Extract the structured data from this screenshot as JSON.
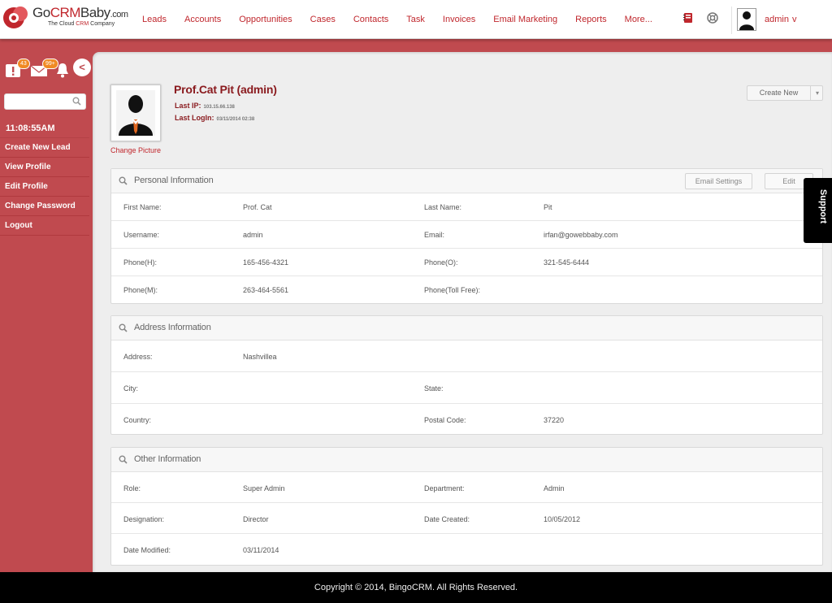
{
  "brand": {
    "name_part1": "Go",
    "name_part2": "CRM",
    "name_part3": "Baby",
    "name_suffix": ".com",
    "tagline_pre": "The Cloud ",
    "tagline_mid": "CRM",
    "tagline_post": " Company",
    "accent_color": "#c0272d",
    "sidebar_color": "#c04a4f"
  },
  "nav": {
    "items": [
      "Leads",
      "Accounts",
      "Opportunities",
      "Cases",
      "Contacts",
      "Task",
      "Invoices",
      "Email Marketing",
      "Reports",
      "More..."
    ]
  },
  "top_icons": [
    "notebook-icon",
    "help-lifebuoy-icon"
  ],
  "user": {
    "name": "admin",
    "caret": "v"
  },
  "sidebar": {
    "alerts_badge": "43",
    "mail_badge": "99+",
    "collapse_symbol": "<",
    "search_placeholder": "",
    "time": "11:08:55AM",
    "links": [
      "Create New Lead",
      "View Profile",
      "Edit Profile",
      "Change Password",
      "Logout"
    ]
  },
  "profile": {
    "name": "Prof.Cat Pit (admin)",
    "last_ip_label": "Last IP:",
    "last_ip": "103.15.66.138",
    "last_login_label": "Last LogIn:",
    "last_login": "03/11/2014 02:38",
    "change_picture": "Change Picture",
    "create_new": "Create New",
    "create_caret": "▾"
  },
  "personal": {
    "title": "Personal Information",
    "email_settings_btn": "Email Settings",
    "edit_btn": "Edit",
    "rows": [
      {
        "l1": "First Name:",
        "v1": "Prof. Cat",
        "l2": "Last Name:",
        "v2": "Pit"
      },
      {
        "l1": "Username:",
        "v1": "admin",
        "l2": "Email:",
        "v2": "irfan@gowebbaby.com"
      },
      {
        "l1": "Phone(H):",
        "v1": "165-456-4321",
        "l2": "Phone(O):",
        "v2": "321-545-6444"
      },
      {
        "l1": "Phone(M):",
        "v1": "263-464-5561",
        "l2": "Phone(Toll Free):",
        "v2": ""
      }
    ]
  },
  "address": {
    "title": "Address Information",
    "rows": [
      {
        "l1": "Address:",
        "v1": "Nashvillea",
        "l2": "",
        "v2": ""
      },
      {
        "l1": "City:",
        "v1": "",
        "l2": "State:",
        "v2": ""
      },
      {
        "l1": "Country:",
        "v1": "",
        "l2": "Postal Code:",
        "v2": "37220"
      }
    ]
  },
  "other": {
    "title": "Other Information",
    "rows": [
      {
        "l1": "Role:",
        "v1": "Super Admin",
        "l2": "Department:",
        "v2": "Admin"
      },
      {
        "l1": "Designation:",
        "v1": "Director",
        "l2": "Date Created:",
        "v2": "10/05/2012"
      },
      {
        "l1": "Date Modified:",
        "v1": "03/11/2014",
        "l2": "",
        "v2": ""
      }
    ]
  },
  "support_tab": "Support",
  "footer": "Copyright © 2014, BingoCRM. All Rights Reserved."
}
